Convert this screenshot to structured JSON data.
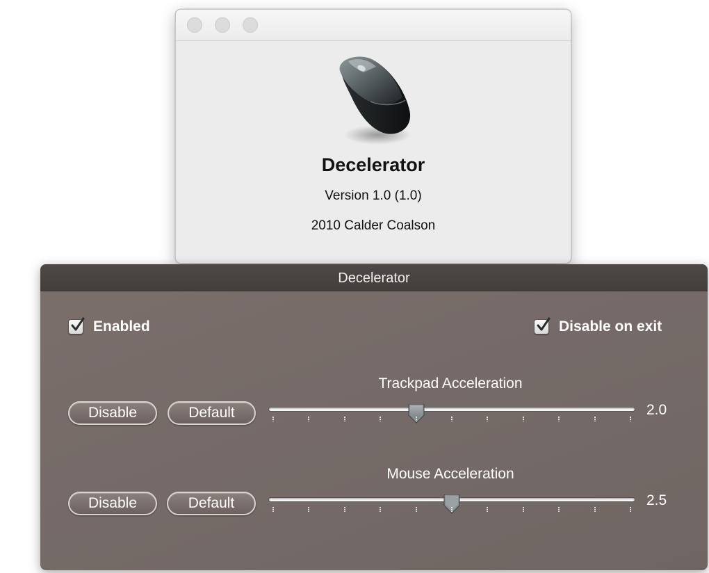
{
  "about_window": {
    "app_name": "Decelerator",
    "version": "Version 1.0 (1.0)",
    "copyright": "2010 Calder Coalson",
    "icon": "mouse-icon",
    "window_controls": [
      "close-button",
      "minimize-button",
      "zoom-button"
    ]
  },
  "hud": {
    "title": "Decelerator",
    "enabled": {
      "label": "Enabled",
      "checked": true
    },
    "disable_on_exit": {
      "label": "Disable on exit",
      "checked": true
    },
    "trackpad": {
      "title": "Trackpad Acceleration",
      "disable_label": "Disable",
      "default_label": "Default",
      "value_text": "2.0",
      "value": 2.0
    },
    "mouse": {
      "title": "Mouse Acceleration",
      "disable_label": "Disable",
      "default_label": "Default",
      "value_text": "2.5",
      "value": 2.5
    }
  },
  "colors": {
    "hud_background": "#766b68",
    "hud_titlebar": "#433e3b",
    "about_background": "#ececec"
  }
}
